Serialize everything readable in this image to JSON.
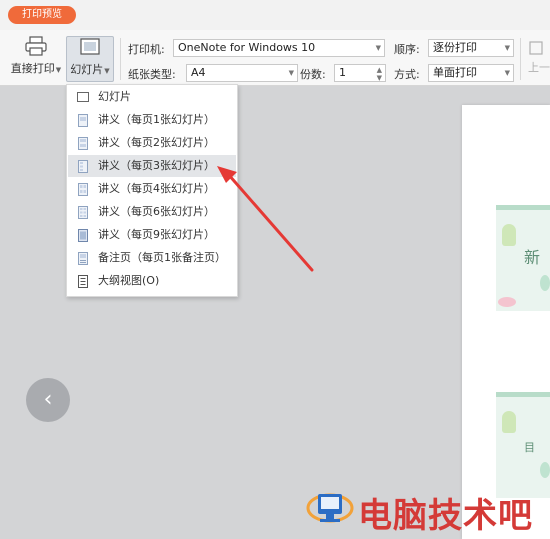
{
  "titlebar": {
    "badge": "打印预览"
  },
  "toolbar": {
    "direct_print": "直接打印",
    "slides": "幻灯片",
    "printer_label": "打印机:",
    "printer_value": "OneNote for Windows 10",
    "paper_label": "纸张类型:",
    "paper_value": "A4",
    "copies_label": "份数:",
    "copies_value": "1",
    "order_label": "顺序:",
    "order_value": "逐份打印",
    "mode_label": "方式:",
    "mode_value": "单面打印",
    "prev_page": "上一"
  },
  "menu": {
    "items": [
      {
        "label": "幻灯片",
        "icon": "slide-icon"
      },
      {
        "label": "讲义（每页1张幻灯片）",
        "icon": "handout-icon"
      },
      {
        "label": "讲义（每页2张幻灯片）",
        "icon": "handout-icon"
      },
      {
        "label": "讲义（每页3张幻灯片）",
        "icon": "handout-icon"
      },
      {
        "label": "讲义（每页4张幻灯片）",
        "icon": "handout-icon"
      },
      {
        "label": "讲义（每页6张幻灯片）",
        "icon": "handout-icon"
      },
      {
        "label": "讲义（每页9张幻灯片）",
        "icon": "handout-icon"
      },
      {
        "label": "备注页（每页1张备注页）",
        "icon": "notes-page-icon"
      },
      {
        "label": "大纲视图(O)",
        "icon": "outline-icon"
      }
    ]
  },
  "preview": {
    "thumb1_text": "新",
    "thumb2_text": "目"
  },
  "watermark": {
    "text": "电脑技术吧"
  },
  "colors": {
    "accent": "#f06a3a",
    "arrow": "#e53935",
    "watermark": "#d43a37"
  }
}
